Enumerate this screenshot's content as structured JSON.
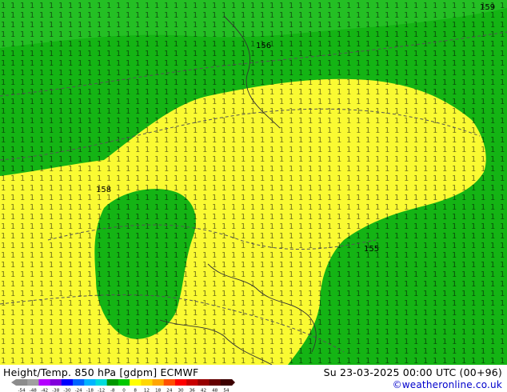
{
  "header": {
    "title": "Height/Temp. 850 hPa [gdpm] ECMWF",
    "datetime": "Su 23-03-2025 00:00 UTC (00+96)",
    "credit": "©weatheronline.co.uk"
  },
  "legend": {
    "ticks": [
      "-54",
      "-48",
      "-42",
      "-38",
      "-30",
      "-24",
      "-18",
      "-12",
      "-8",
      "0",
      "8",
      "12",
      "18",
      "24",
      "30",
      "36",
      "42",
      "48",
      "54"
    ],
    "colors": [
      "#8c8c8c",
      "#a0a0a0",
      "#b400ff",
      "#8200dc",
      "#0000ff",
      "#0064ff",
      "#00b4ff",
      "#00dcdc",
      "#009600",
      "#00c800",
      "#ffff00",
      "#ffd700",
      "#ffa500",
      "#ff5000",
      "#ff0000",
      "#c80000",
      "#960000",
      "#640000",
      "#3c0000"
    ]
  },
  "map": {
    "field_colors": {
      "green": "#14b414",
      "light_green": "#32c832",
      "yellow": "#fafa32"
    },
    "contour_labels": [
      "155",
      "156",
      "158",
      "159"
    ]
  }
}
